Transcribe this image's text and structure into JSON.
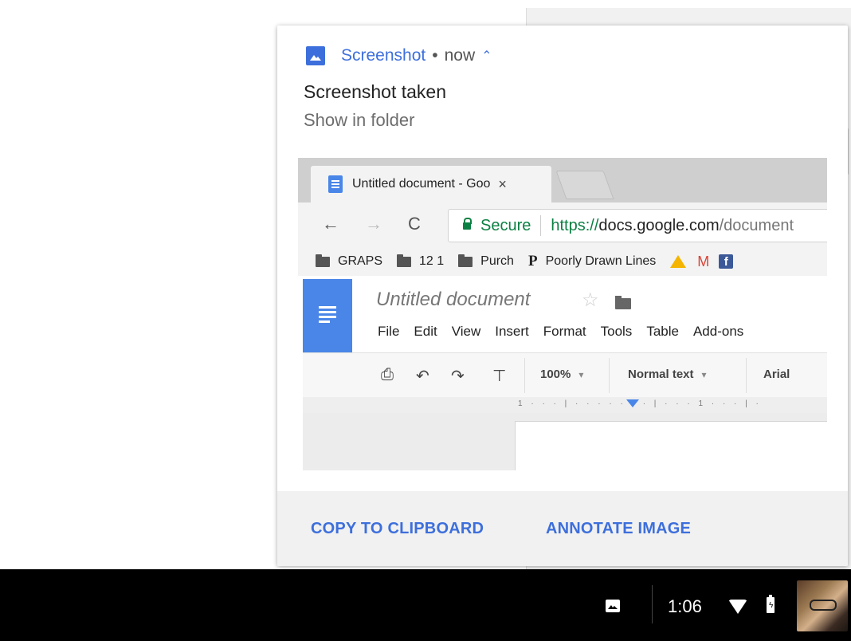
{
  "notification": {
    "app_name": "Screenshot",
    "separator": "•",
    "time": "now",
    "title": "Screenshot taken",
    "subtitle": "Show in folder",
    "actions": {
      "copy": "COPY TO CLIPBOARD",
      "annotate": "ANNOTATE IMAGE"
    },
    "accent_color": "#3d6fdc"
  },
  "preview": {
    "tab": {
      "title": "Untitled document - Goo",
      "close_glyph": "×"
    },
    "nav": {
      "back": "←",
      "forward": "→",
      "reload": "C"
    },
    "address": {
      "secure_label": "Secure",
      "scheme": "https://",
      "host": "docs.google.com",
      "path": "/document"
    },
    "bookmarks": [
      "GRAPS",
      "12 1",
      "Purch",
      "Poorly Drawn Lines"
    ],
    "bookmark_p_glyph": "P",
    "gmail_glyph": "M",
    "facebook_glyph": "f",
    "doc": {
      "title": "Untitled document",
      "star_glyph": "☆",
      "menu": [
        "File",
        "Edit",
        "View",
        "Insert",
        "Format",
        "Tools",
        "Table",
        "Add-ons"
      ],
      "zoom": "100%",
      "style": "Normal text",
      "font": "Arial",
      "ruler_text": "1 · · · | · · · · · · · | · · · 1 · · · | ·"
    }
  },
  "shelf": {
    "time": "1:06"
  }
}
